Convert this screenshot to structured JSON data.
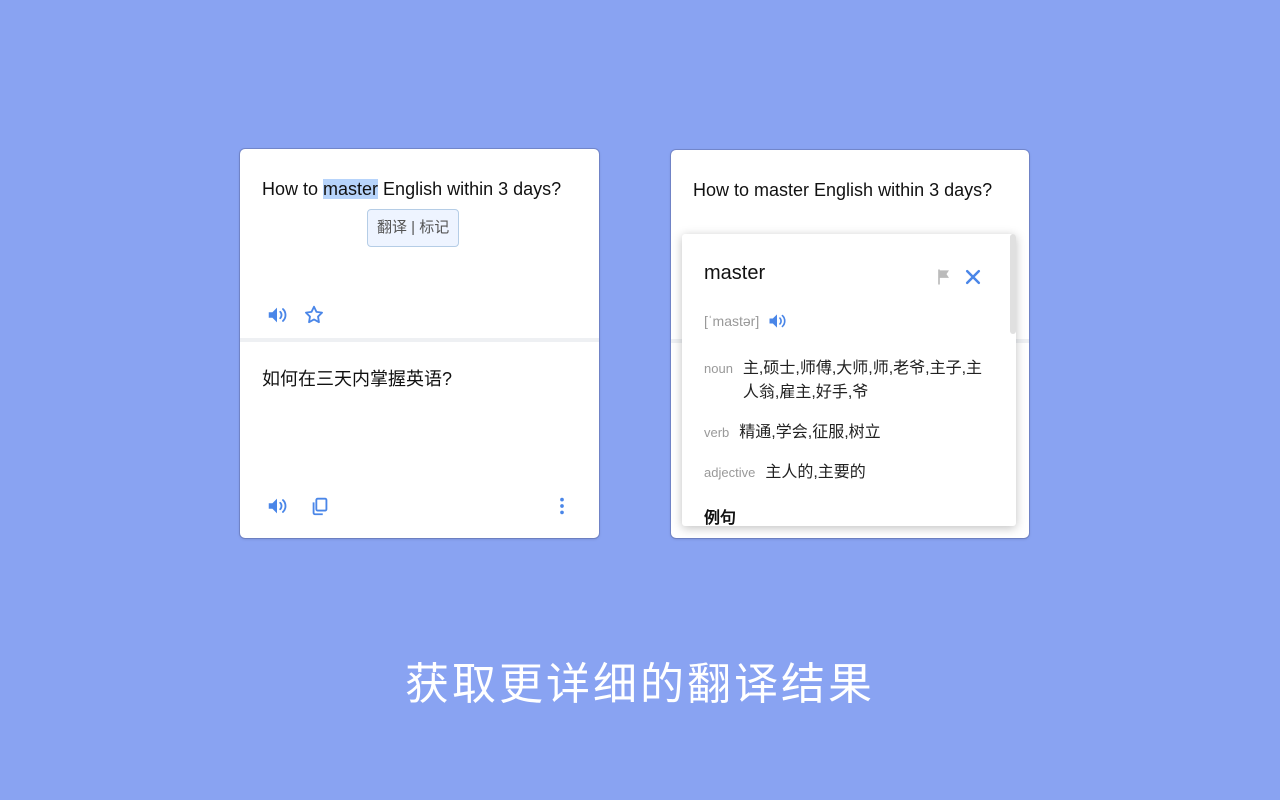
{
  "left_card": {
    "source_before": "How to ",
    "source_highlight": "master",
    "source_after": " English within 3 days?",
    "tooltip": "翻译 | 标记",
    "translation": "如何在三天内掌握英语?"
  },
  "right_card": {
    "source": "How to master English within 3 days?",
    "popup": {
      "word": "master",
      "phonetic": "[ˈmastər]",
      "definitions": [
        {
          "pos": "noun",
          "meaning": "主,硕士,师傅,大师,师,老爷,主子,主人翁,雇主,好手,爷"
        },
        {
          "pos": "verb",
          "meaning": "精通,学会,征服,树立"
        },
        {
          "pos": "adjective",
          "meaning": "主人的,主要的"
        }
      ],
      "example_heading": "例句"
    }
  },
  "caption": "获取更详细的翻译结果",
  "colors": {
    "background": "#89a3f2",
    "accent": "#4a86e8"
  }
}
